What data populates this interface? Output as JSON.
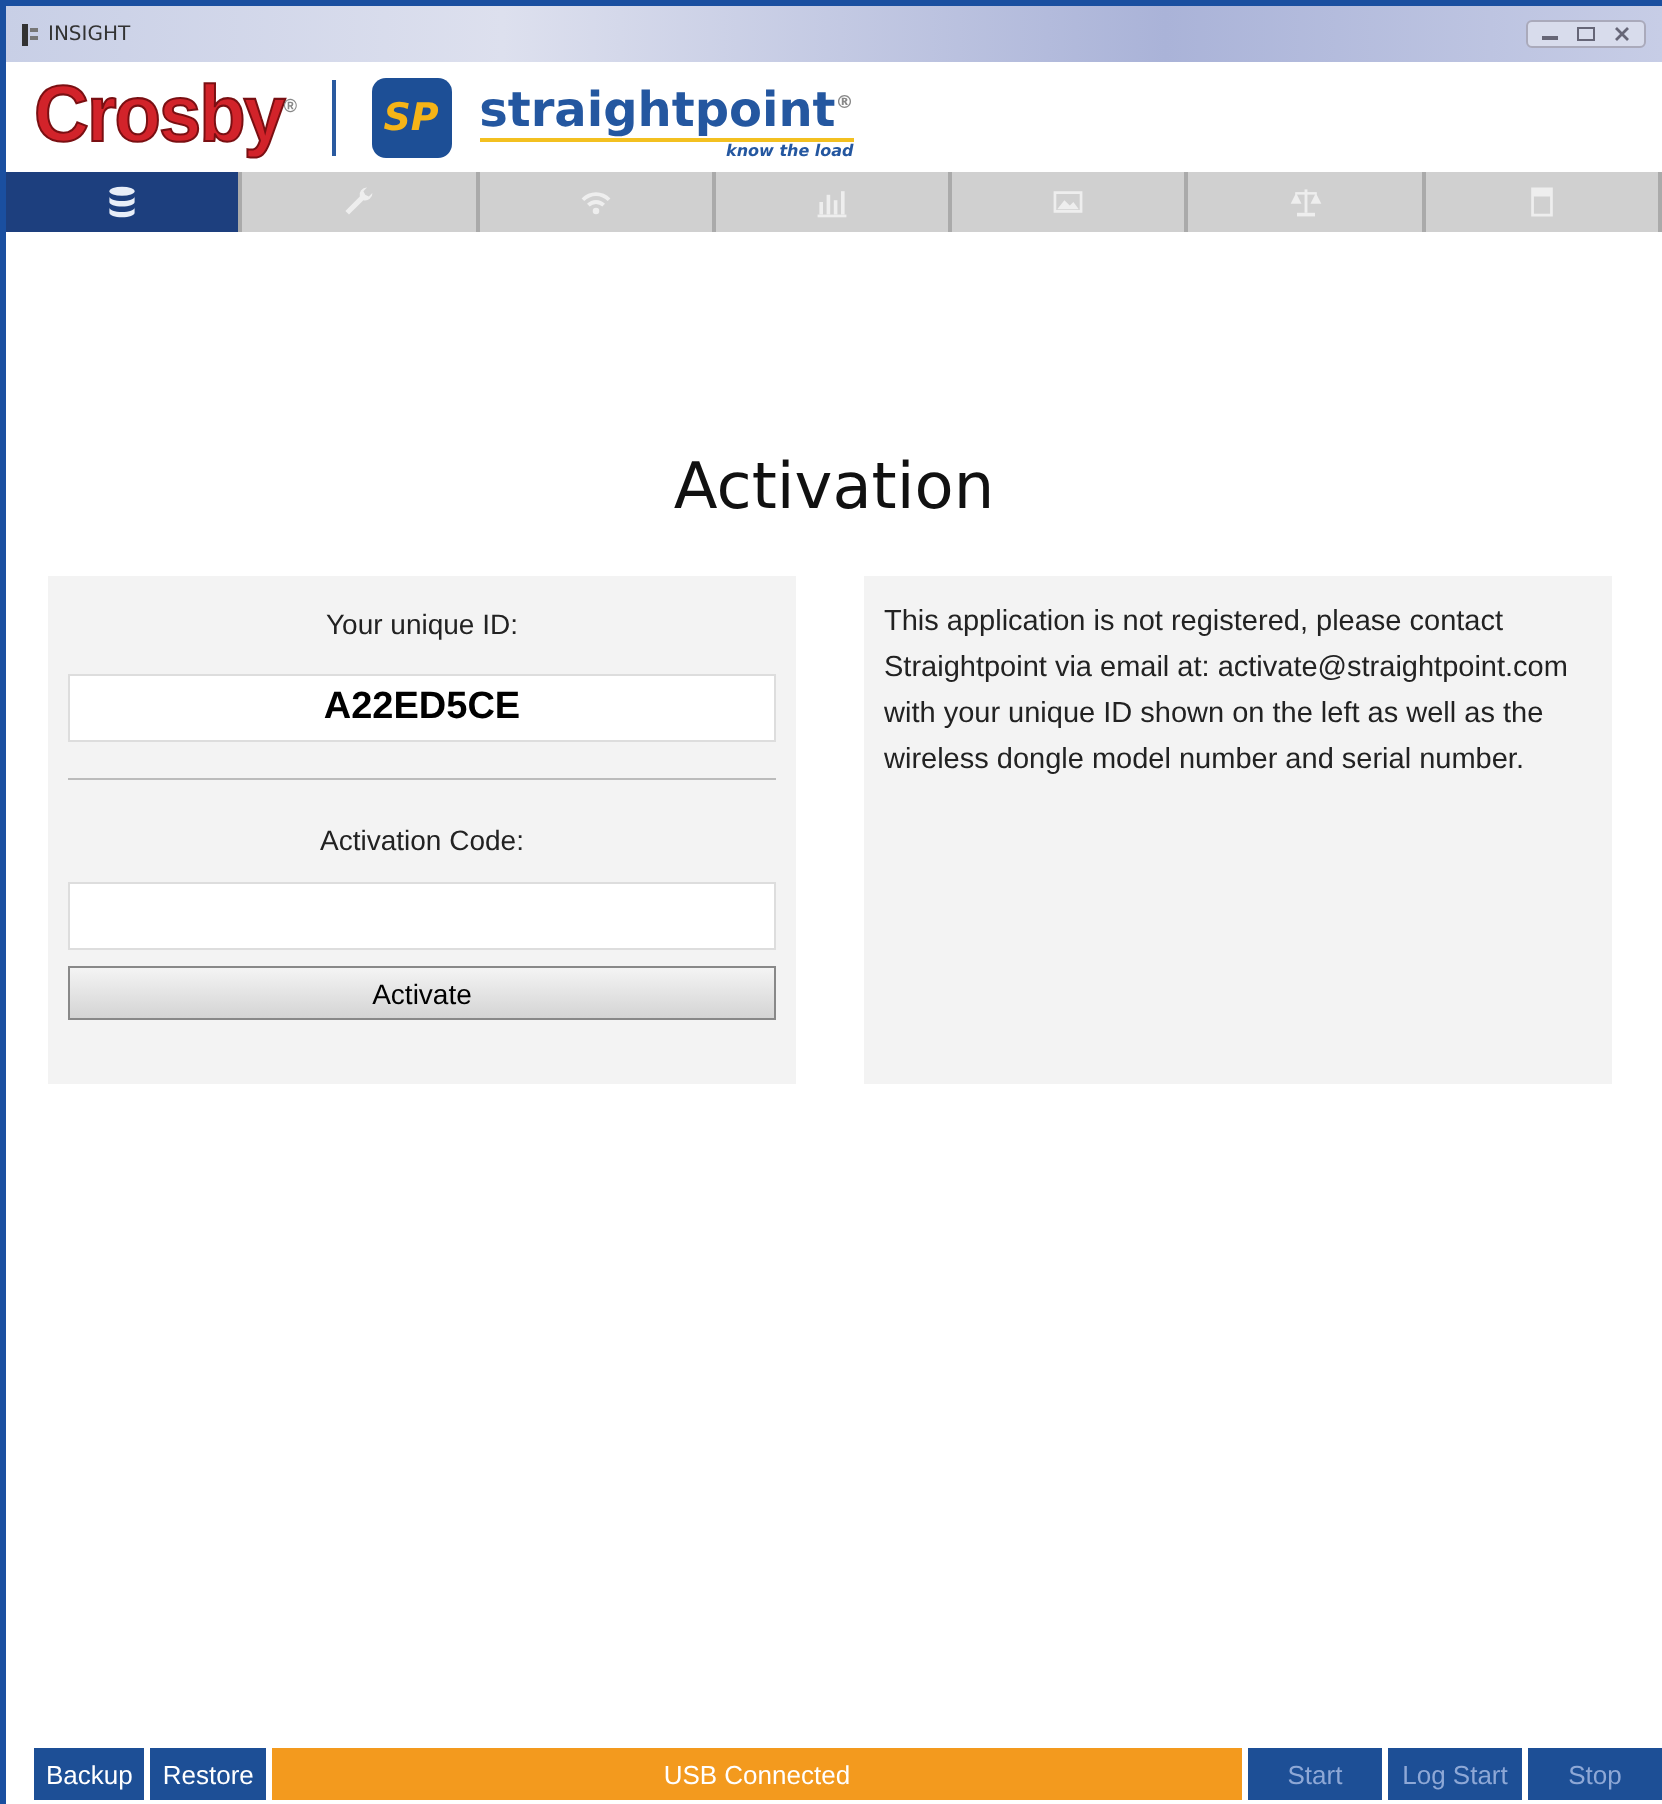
{
  "window": {
    "title": "INSIGHT"
  },
  "header": {
    "brand": "Crosby",
    "brand_mark": "®",
    "logo_badge": "SP",
    "product": "straightpoint",
    "product_mark": "®",
    "tagline": "know the load"
  },
  "tabs": [
    {
      "kind": "database",
      "selected": true
    },
    {
      "kind": "wrench",
      "selected": false
    },
    {
      "kind": "wifi",
      "selected": false
    },
    {
      "kind": "chart",
      "selected": false
    },
    {
      "kind": "image",
      "selected": false
    },
    {
      "kind": "scale",
      "selected": false
    },
    {
      "kind": "panel",
      "selected": false
    }
  ],
  "page_title": "Activation",
  "form": {
    "id_label": "Your unique ID:",
    "id_value": "A22ED5CE",
    "code_label": "Activation Code:",
    "activate_button": "Activate"
  },
  "message": "This application is not registered, please contact Straightpoint via email at: activate@straightpoint.com with your unique ID shown on the left as well as the wireless dongle model number and serial number.",
  "status_bar": {
    "left_buttons": [
      {
        "label": "Backup",
        "disabled": false
      },
      {
        "label": "Restore",
        "disabled": false
      }
    ],
    "status": "USB Connected",
    "right_buttons": [
      {
        "label": "Start",
        "disabled": true
      },
      {
        "label": "Log Start",
        "disabled": true
      },
      {
        "label": "Stop",
        "disabled": true
      }
    ]
  }
}
